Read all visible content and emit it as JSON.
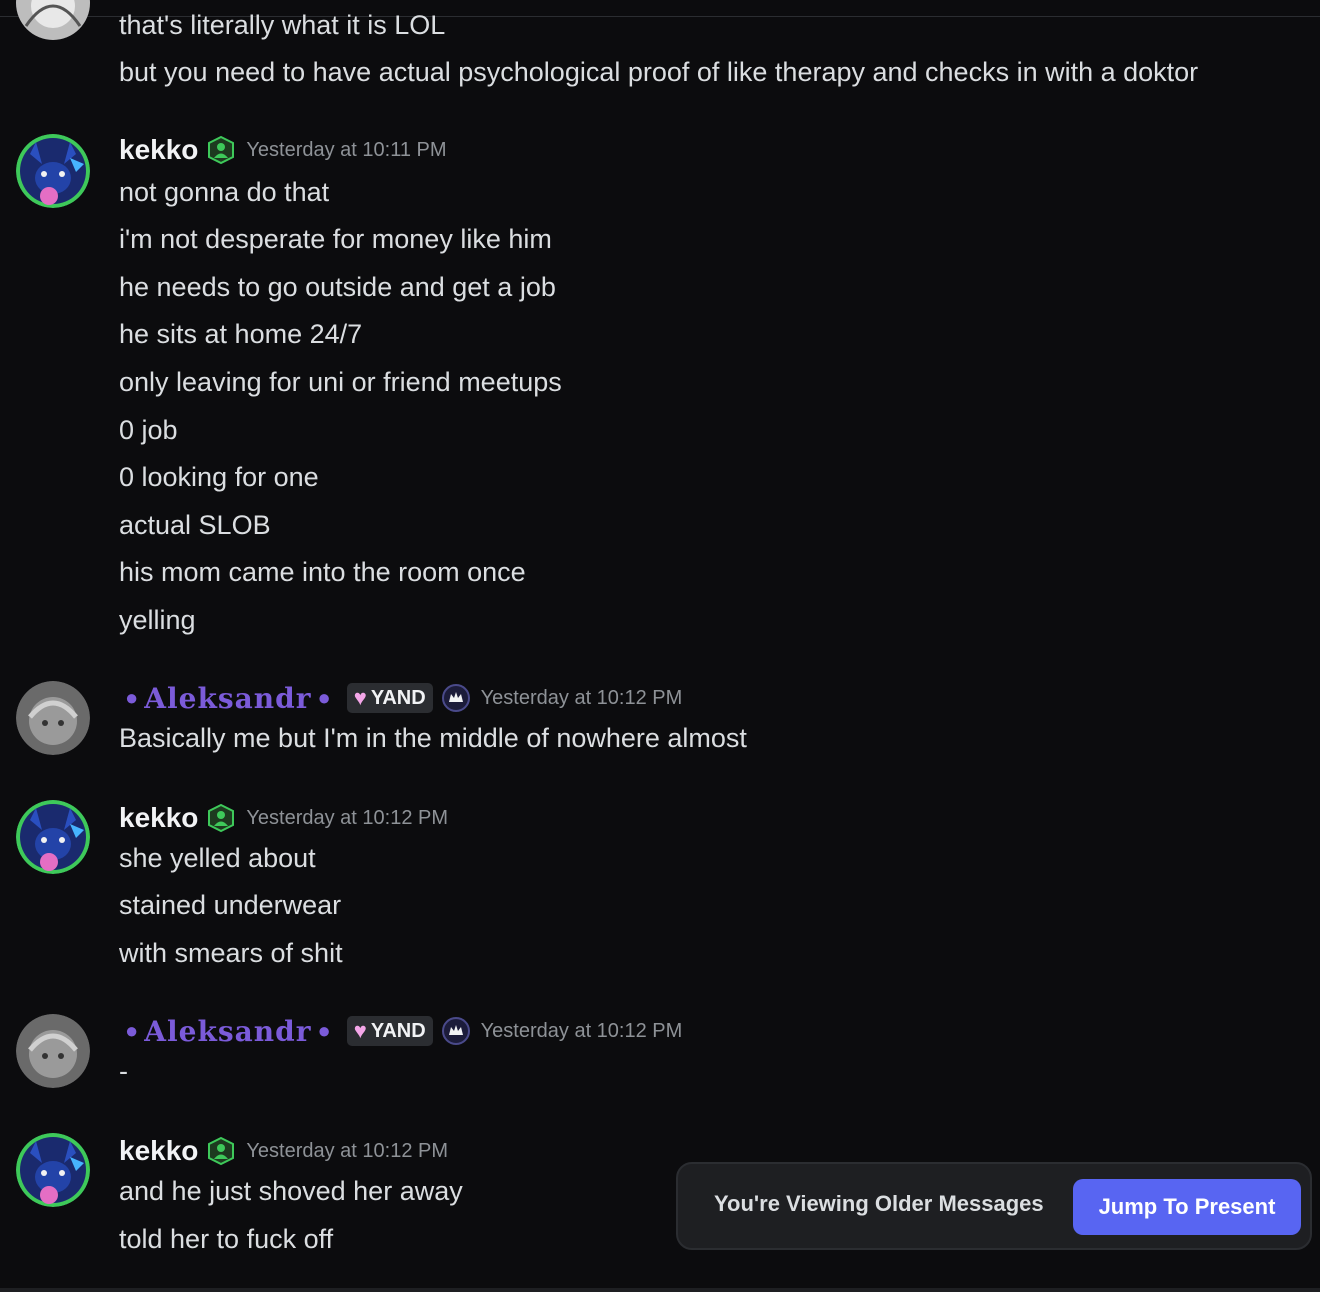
{
  "colors": {
    "background": "#0c0c0e",
    "text": "#dbdee1",
    "username_default": "#f2f3f5",
    "username_aleksandr": "#7b5bd9",
    "timestamp": "#8e9297",
    "accent_button": "#5865f2"
  },
  "icons": {
    "role_green": "person-badge-icon",
    "role_crown": "crown-badge-icon",
    "heart": "heart-icon"
  },
  "partial_top": {
    "lines": [
      "that's literally what it is LOL",
      "but you need to have actual psychological proof of like therapy and checks in with a doktor"
    ]
  },
  "messages": [
    {
      "author": "kekko",
      "timestamp": "Yesterday at 10:11 PM",
      "lines": [
        "not gonna do that",
        "i'm not desperate for money like him",
        "he needs to go outside and get a job",
        "he sits at home 24/7",
        "only leaving for uni or friend meetups",
        "0 job",
        "0 looking for one",
        "actual SLOB",
        "his mom came into the room once",
        "yelling"
      ]
    },
    {
      "author": "Aleksandr",
      "tag": "YAND",
      "timestamp": "Yesterday at 10:12 PM",
      "lines": [
        "Basically me but I'm in the middle of nowhere almost"
      ]
    },
    {
      "author": "kekko",
      "timestamp": "Yesterday at 10:12 PM",
      "lines": [
        "she yelled about",
        "stained underwear",
        "with smears of shit"
      ]
    },
    {
      "author": "Aleksandr",
      "tag": "YAND",
      "timestamp": "Yesterday at 10:12 PM",
      "lines": [
        "-"
      ]
    },
    {
      "author": "kekko",
      "timestamp": "Yesterday at 10:12 PM",
      "lines": [
        "and he just shoved her away",
        "told her to fuck off"
      ]
    }
  ],
  "banner": {
    "text": "You're Viewing Older Messages",
    "button_label": "Jump To Present"
  }
}
